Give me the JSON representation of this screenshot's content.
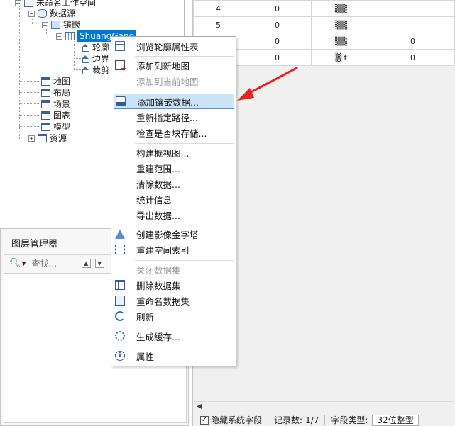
{
  "tree": {
    "workspace": "未命名工作空间",
    "datasources": "数据源",
    "mosaic_group": "镶嵌",
    "mosaic_dataset": "ShuangGang",
    "child_footprint": "轮廓",
    "child_boundary": "边界",
    "child_clip": "裁剪",
    "maps": "地图",
    "layouts": "布局",
    "scenes": "场景",
    "charts": "图表",
    "models": "模型",
    "resources": "资源"
  },
  "layer_manager": {
    "title": "图层管理器",
    "search_placeholder": "查找..."
  },
  "attribute_table": {
    "rows": [
      {
        "id": "4",
        "c1": "0",
        "c2": "▒▒",
        "c3": ""
      },
      {
        "id": "5",
        "c1": "0",
        "c2": "▒▒",
        "c3": ""
      },
      {
        "id": "",
        "c1": "0",
        "c2": "▒▒",
        "c3": "0"
      },
      {
        "id": "",
        "c1": "0",
        "c2": "▒ f",
        "c3": "0"
      }
    ]
  },
  "status_bar": {
    "hide_system_fields": "隐藏系统字段",
    "record_count_label": "记录数:",
    "record_count_value": "1/7",
    "field_type_label": "字段类型:",
    "field_type_value": "32位整型"
  },
  "context_menu": {
    "items": [
      {
        "label": "浏览轮廓属性表",
        "icon": "table-icon",
        "enabled": true
      },
      {
        "label": "添加到新地图",
        "icon": "add-map-icon",
        "enabled": true
      },
      {
        "label": "添加到当前地图",
        "icon": "",
        "enabled": false
      },
      {
        "label": "添加镶嵌数据...",
        "icon": "disk-icon",
        "enabled": true,
        "highlighted": true
      },
      {
        "label": "重新指定路径...",
        "icon": "",
        "enabled": true
      },
      {
        "label": "检查是否块存储...",
        "icon": "",
        "enabled": true
      },
      {
        "label": "构建概视图...",
        "icon": "",
        "enabled": true
      },
      {
        "label": "重建范围...",
        "icon": "",
        "enabled": true
      },
      {
        "label": "清除数据...",
        "icon": "",
        "enabled": true
      },
      {
        "label": "统计信息",
        "icon": "",
        "enabled": true
      },
      {
        "label": "导出数据...",
        "icon": "",
        "enabled": true
      },
      {
        "label": "创建影像金字塔",
        "icon": "pyramid-icon",
        "enabled": true
      },
      {
        "label": "重建空间索引",
        "icon": "spatial-index-icon",
        "enabled": true
      },
      {
        "label": "关闭数据集",
        "icon": "",
        "enabled": false
      },
      {
        "label": "删除数据集",
        "icon": "trash-icon",
        "enabled": true
      },
      {
        "label": "重命名数据集",
        "icon": "rename-icon",
        "enabled": true
      },
      {
        "label": "刷新",
        "icon": "refresh-icon",
        "enabled": true
      },
      {
        "label": "生成缓存...",
        "icon": "cache-icon",
        "enabled": true
      },
      {
        "label": "属性",
        "icon": "info-icon",
        "enabled": true
      }
    ]
  },
  "colors": {
    "selection_blue": "#0078d7",
    "menu_highlight": "#cce4f7",
    "arrow_red": "#e8231f"
  }
}
